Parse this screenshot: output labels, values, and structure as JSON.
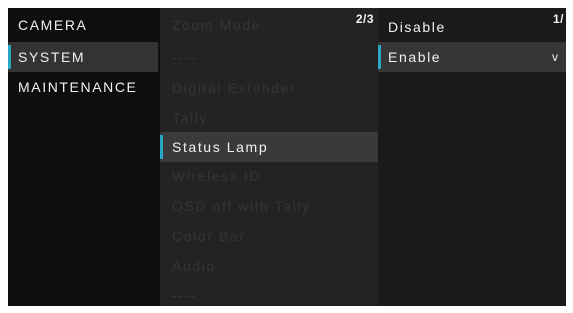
{
  "main_menu": {
    "items": [
      {
        "label": "CAMERA"
      },
      {
        "label": "SYSTEM"
      },
      {
        "label": "MAINTENANCE"
      }
    ],
    "selected": 1
  },
  "submenu": {
    "page_indicator": "2/3",
    "items": [
      {
        "label": "Zoom Mode"
      },
      {
        "label": "----"
      },
      {
        "label": "Digital Extender"
      },
      {
        "label": "Tally"
      },
      {
        "label": "Status Lamp"
      },
      {
        "label": "Wireless ID"
      },
      {
        "label": "OSD off with Tally"
      },
      {
        "label": "Color Bar"
      },
      {
        "label": "Audio"
      },
      {
        "label": "----"
      }
    ],
    "selected": 4
  },
  "options": {
    "page_indicator": "1/",
    "items": [
      {
        "label": "Disable"
      },
      {
        "label": "Enable"
      }
    ],
    "selected": 1,
    "check_mark": "v"
  },
  "colors": {
    "accent": "#2aa7c4",
    "disabled_text": "#353535",
    "text": "#f1f1f1"
  }
}
